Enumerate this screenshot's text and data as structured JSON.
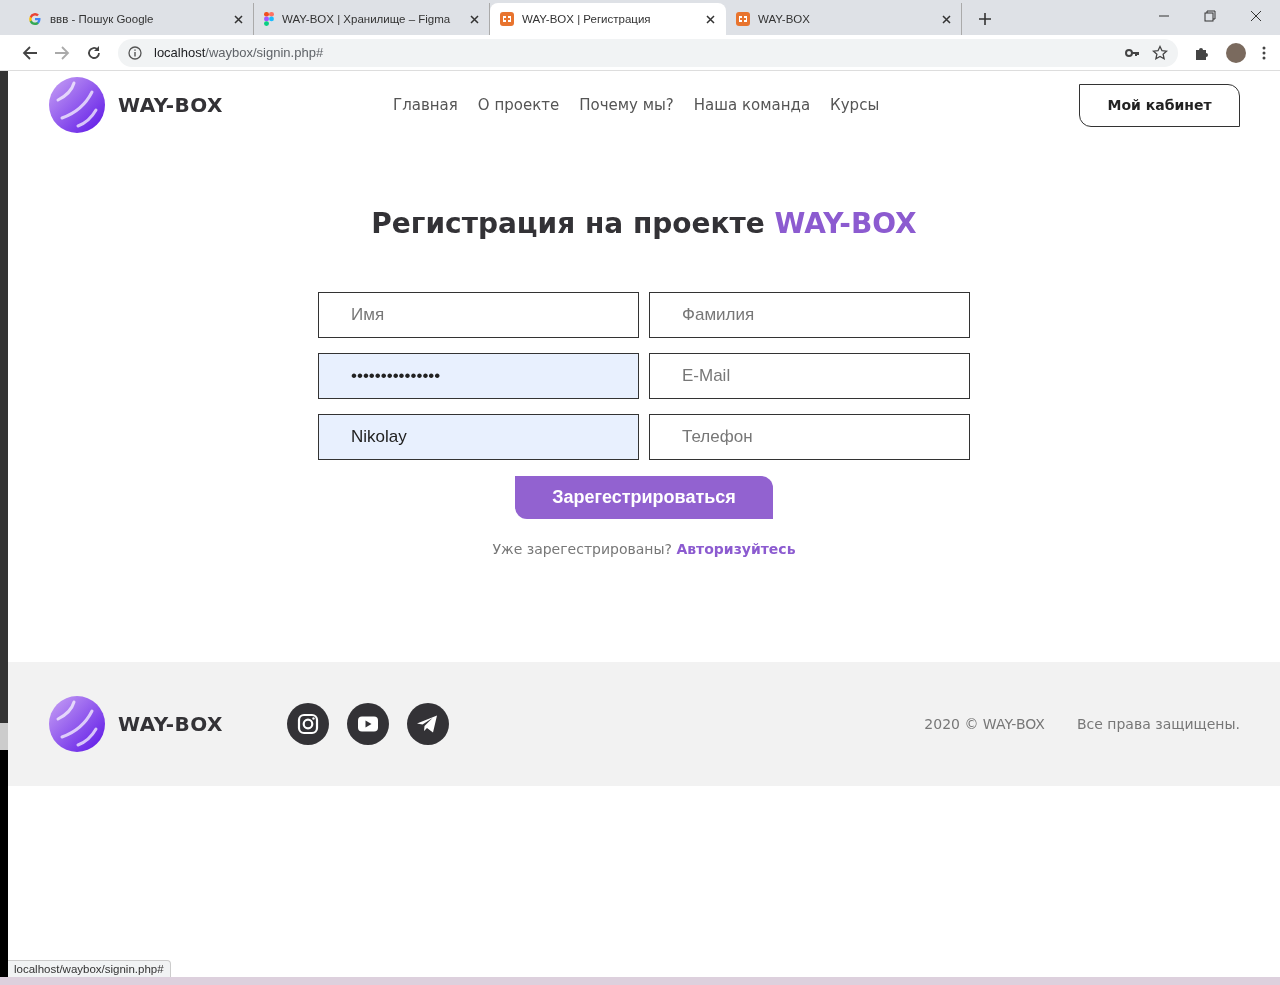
{
  "browser": {
    "tabs": [
      {
        "title": "ввв - Пошук Google",
        "selected": false
      },
      {
        "title": "WAY-BOX | Хранилище – Figma",
        "selected": false
      },
      {
        "title": "WAY-BOX | Регистрация",
        "selected": true
      },
      {
        "title": "WAY-BOX",
        "selected": false
      }
    ],
    "address": {
      "host": "localhost",
      "path": "/waybox/signin.php#"
    },
    "status_url": "localhost/waybox/signin.php#"
  },
  "header": {
    "brand": "WAY-BOX",
    "nav": [
      "Главная",
      "О проекте",
      "Почему мы?",
      "Наша команда",
      "Курсы"
    ],
    "cabinet_button": "Мой кабинет"
  },
  "form": {
    "title_text": "Регистрация на проекте ",
    "title_accent": "WAY-BOX",
    "fields": [
      {
        "placeholder": "Имя",
        "autofilled": false
      },
      {
        "placeholder": "Фамилия",
        "autofilled": false
      },
      {
        "value": "•••••••••••••••",
        "autofilled": true
      },
      {
        "placeholder": "E-Mail",
        "autofilled": false
      },
      {
        "value": "Nikolay",
        "autofilled": true
      },
      {
        "placeholder": "Телефон",
        "autofilled": false
      }
    ],
    "submit": "Зарегестрироваться",
    "login_prompt": "Уже зарегестрированы?",
    "login_link": "Авторизуйтесь"
  },
  "footer": {
    "brand": "WAY-BOX",
    "socials": [
      {
        "kind": "instagram"
      },
      {
        "kind": "youtube"
      },
      {
        "kind": "telegram"
      }
    ],
    "copyright": "2020 © WAY-BOX",
    "rights": "Все права защищены."
  }
}
